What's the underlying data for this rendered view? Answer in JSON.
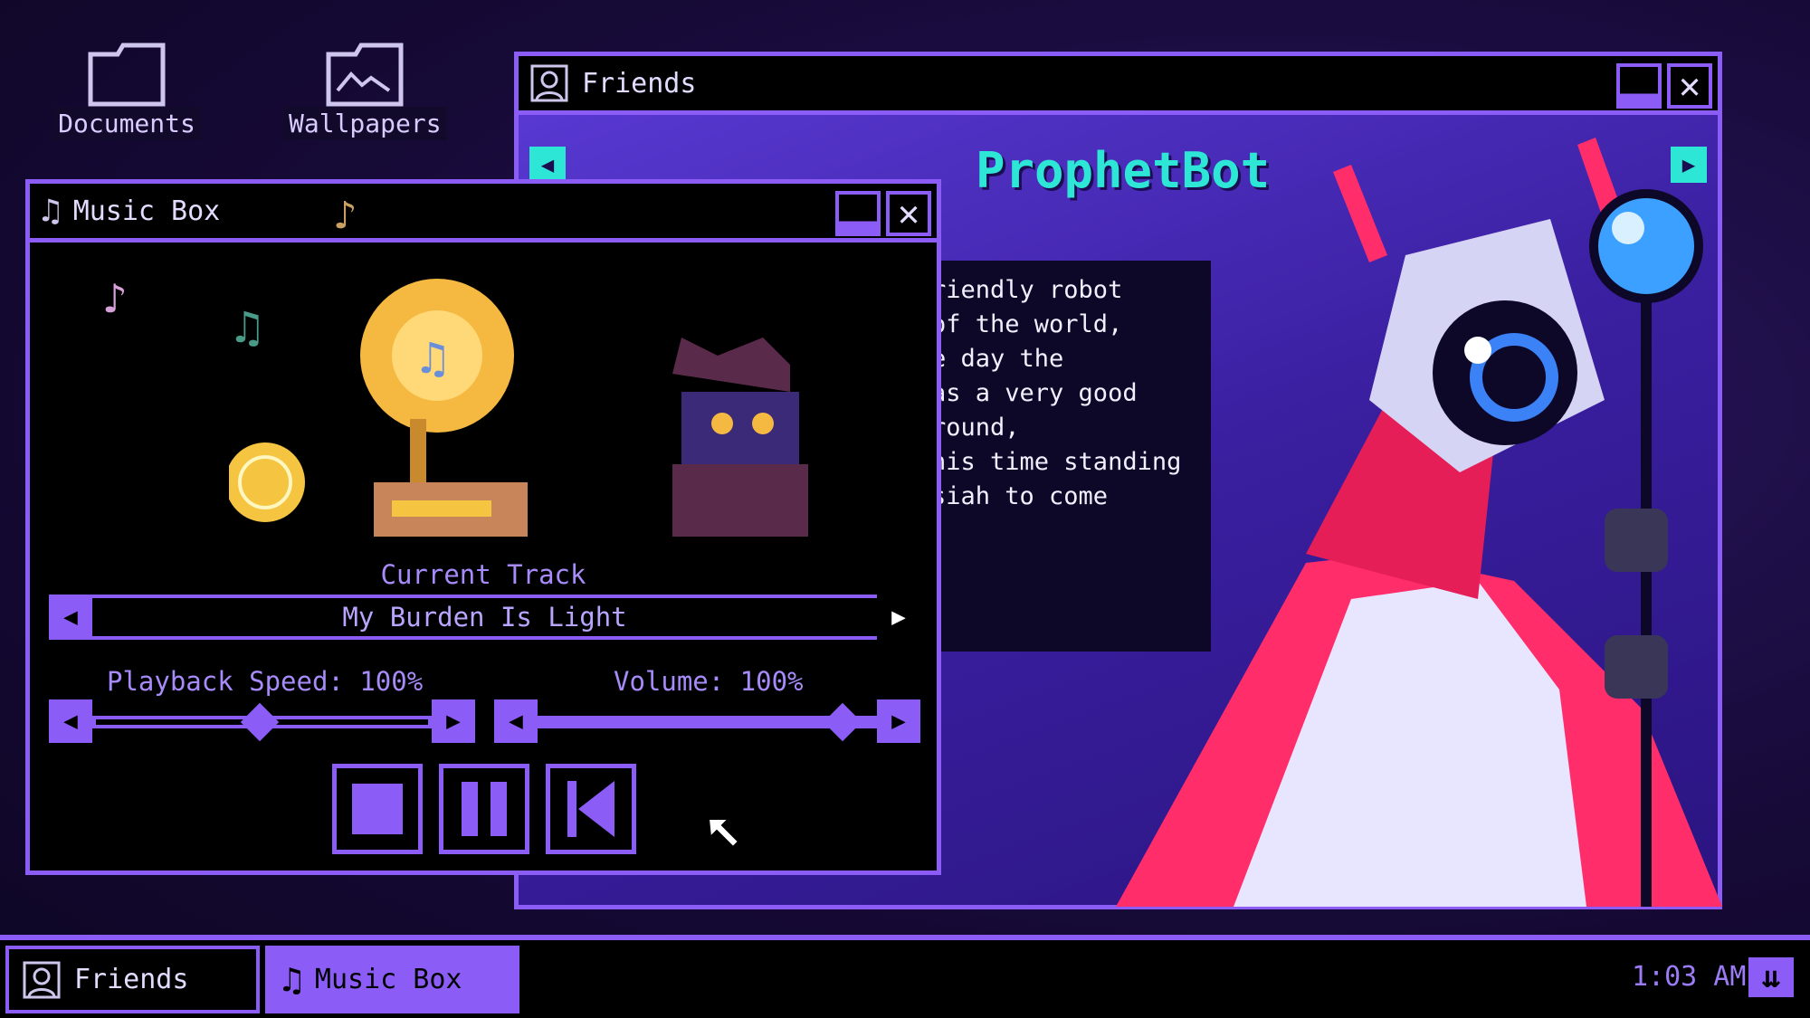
{
  "desktop": {
    "icons": [
      {
        "label": "Documents",
        "icon": "folder-icon"
      },
      {
        "label": "Wallpapers",
        "icon": "image-folder-icon"
      }
    ]
  },
  "friends_window": {
    "title": "Friends",
    "name": "ProphetBot",
    "bio_lines": [
      "riendly robot",
      "of the world,",
      "e day the",
      "as a very good",
      "",
      "",
      "round,",
      "his time standing",
      "siah to come"
    ],
    "accent": "#2ee6d6"
  },
  "music_box": {
    "title": "Music Box",
    "current_track_label": "Current Track",
    "track": "My Burden Is Light",
    "playback_speed_label": "Playback Speed: 100%",
    "volume_label": "Volume: 100%",
    "playback_speed": 1.0,
    "volume": 1.0,
    "controls": [
      "stop",
      "pause",
      "previous"
    ]
  },
  "taskbar": {
    "items": [
      {
        "label": "Friends",
        "icon": "friends-icon"
      },
      {
        "label": "Music Box",
        "icon": "music-note-icon",
        "active": true
      }
    ],
    "clock": "1:03 AM"
  },
  "colors": {
    "accent": "#8b5cf6",
    "bg": "#170a38"
  }
}
